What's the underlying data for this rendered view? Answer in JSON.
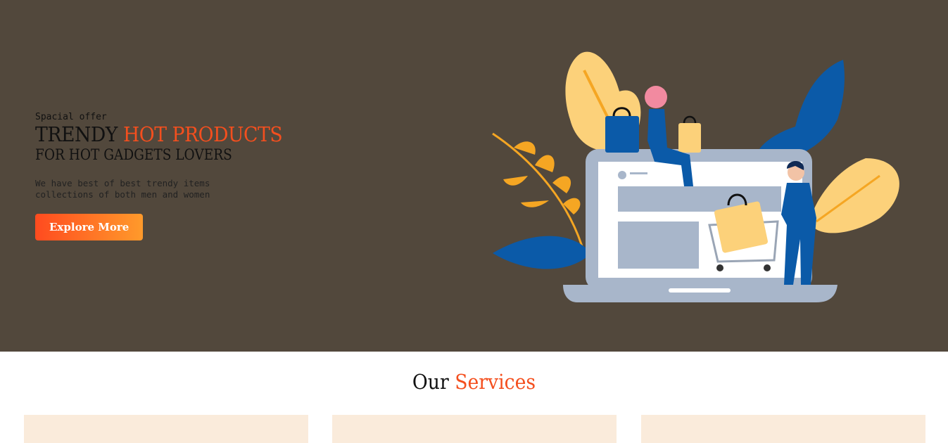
{
  "hero": {
    "eyebrow": "Spacial offer",
    "headline_plain": "TRENDY ",
    "headline_accent": "HOT PRODUCTS",
    "subline": "FOR HOT GADGETS LOVERS",
    "description": "We have best of best trendy items collections of both men and women",
    "cta_label": "Explore More"
  },
  "services": {
    "title_plain": "Our ",
    "title_accent": "Services"
  },
  "colors": {
    "hero_bg": "#52483c",
    "accent": "#f44f1e",
    "card_bg": "#faebdb"
  },
  "illustration_icon": "online-shopping-laptop-illustration"
}
